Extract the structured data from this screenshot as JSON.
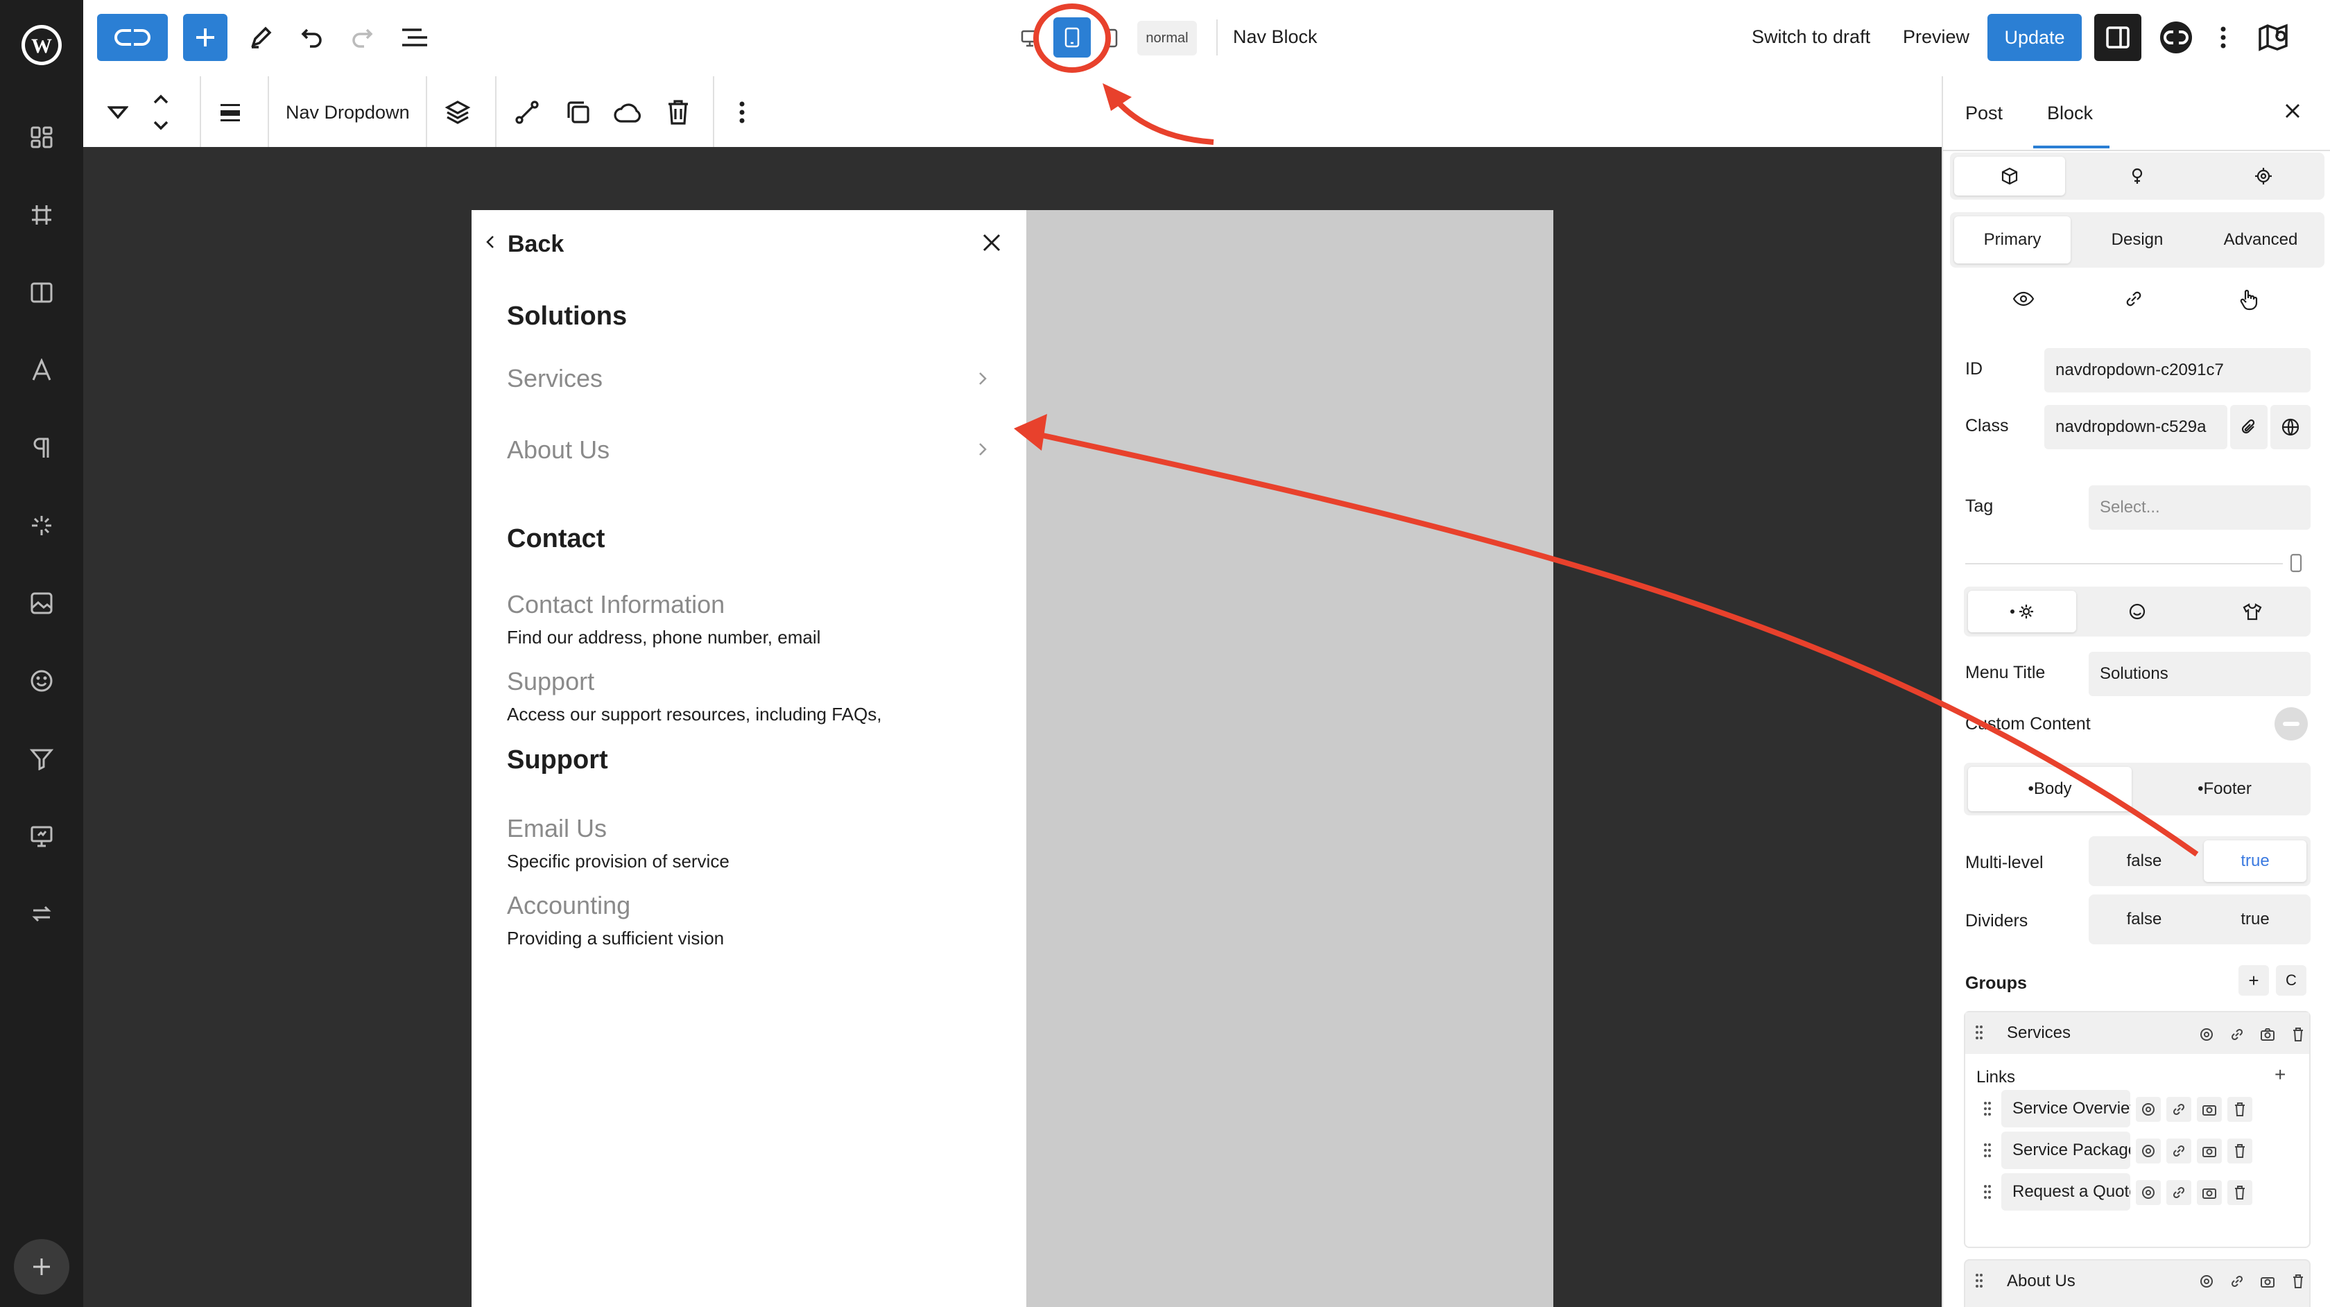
{
  "colors": {
    "accent": "#3858e9",
    "wp_blue": "#2b7fd4",
    "annotation": "#e8412c",
    "rail_bg": "#1e1e1e",
    "canvas_bg": "#2f2f2f",
    "frame_grey": "#cbcbcb",
    "muted_text": "#8a8a8a",
    "link_blue": "#3b7ae0"
  },
  "topbar": {
    "device_mode": "normal",
    "doc_title": "Nav Block",
    "switch_to_draft": "Switch to draft",
    "preview": "Preview",
    "update": "Update",
    "icons": [
      "wordpress-logo-icon",
      "site-logo-icon",
      "add-block-icon",
      "pencil-icon",
      "undo-icon",
      "redo-icon",
      "list-view-icon",
      "desktop-icon",
      "tablet-icon",
      "mobile-icon",
      "settings-sidebar-icon",
      "plugin-logo-icon",
      "more-vertical-icon",
      "map-help-icon"
    ]
  },
  "block_toolbar": {
    "block_name": "Nav Dropdown",
    "icons": [
      "chevron-down-icon",
      "move-up-down-icon",
      "align-icon",
      "layers-icon",
      "link-icon",
      "duplicate-icon",
      "cloud-icon",
      "trash-icon",
      "more-vertical-icon"
    ]
  },
  "rail": {
    "icons": [
      "dashboard-icon",
      "grid-icon",
      "columns-icon",
      "typography-icon",
      "paragraph-icon",
      "sparkle-icon",
      "image-icon",
      "smile-icon",
      "filter-icon",
      "presentation-icon",
      "sync-icon",
      "plus-circle-icon"
    ]
  },
  "preview": {
    "back_label": "Back",
    "sections": [
      {
        "heading": "Solutions",
        "items": [
          {
            "title": "Services"
          },
          {
            "title": "About Us"
          }
        ]
      },
      {
        "heading": "Contact",
        "items": [
          {
            "title": "Contact Information",
            "desc": "Find our address, phone number, email"
          },
          {
            "title": "Support",
            "desc": "Access our support resources, including FAQs,"
          }
        ]
      },
      {
        "heading": "Support",
        "items": [
          {
            "title": "Email Us",
            "desc": "Specific provision of service"
          },
          {
            "title": "Accounting",
            "desc": "Providing a sufficient vision"
          }
        ]
      }
    ]
  },
  "sidebar": {
    "tabs": [
      "Post",
      "Block"
    ],
    "active_tab": "Block",
    "subtabs": [
      "Primary",
      "Design",
      "Advanced"
    ],
    "active_subtab": "Primary",
    "id_label": "ID",
    "id_value": "navdropdown-c2091c7",
    "class_label": "Class",
    "class_value": "navdropdown-c529a",
    "tag_label": "Tag",
    "tag_placeholder": "Select...",
    "menu_title_label": "Menu Title",
    "menu_title_value": "Solutions",
    "custom_content_label": "Custom Content",
    "body_footer": [
      "•Body",
      "•Footer"
    ],
    "multilevel_label": "Multi-level",
    "dividers_label": "Dividers",
    "false_label": "false",
    "true_label": "true",
    "multilevel_value": "true",
    "groups_label": "Groups",
    "group_services": "Services",
    "links_label": "Links",
    "links": [
      "Service Overview",
      "Service Package",
      "Request a Quote"
    ],
    "group_about": "About Us",
    "plus": "+",
    "c": "C"
  }
}
